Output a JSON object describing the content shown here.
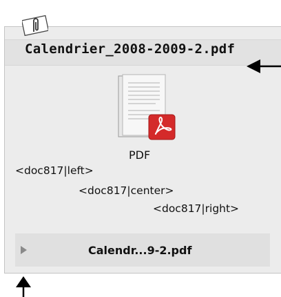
{
  "attachment": {
    "title": "Calendrier_2008-2009-2.pdf",
    "icon": "pdf-document-icon",
    "type_label": "PDF",
    "clip_icon": "paperclip-icon"
  },
  "code_lines": {
    "left": "<doc817|left>",
    "center": "<doc817|center>",
    "right": "<doc817|right>"
  },
  "footer": {
    "toggle_icon": "triangle-right-icon",
    "filename": "Calendr...9-2.pdf"
  },
  "annotations": {
    "arrow_left_icon": "arrow-left-icon",
    "arrow_up_icon": "arrow-up-icon"
  },
  "colors": {
    "panel_bg": "#ececec",
    "pdf_badge": "#d42a2a"
  }
}
